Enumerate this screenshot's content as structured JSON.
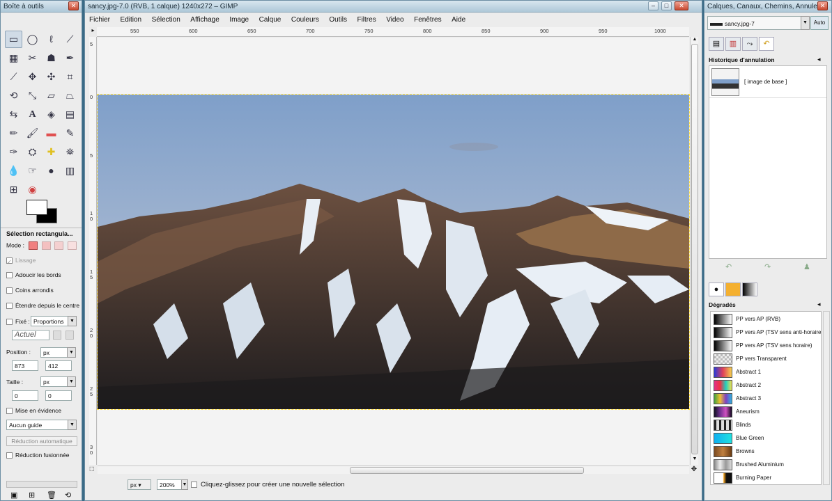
{
  "toolbox": {
    "title": "Boîte à outils",
    "options_title": "Sélection rectangula...",
    "mode_label": "Mode :",
    "antialias_label": "Lissage",
    "feather_label": "Adoucir les bords",
    "rounded_label": "Coins arrondis",
    "expand_label": "Étendre depuis le centre",
    "fixed_label": "Fixé :",
    "fixed_value": "Proportions",
    "current_label": "Actuel",
    "position_label": "Position :",
    "position_unit": "px",
    "position_x": "873",
    "position_y": "412",
    "size_label": "Taille :",
    "size_unit": "px",
    "size_w": "0",
    "size_h": "0",
    "highlight_label": "Mise en évidence",
    "guide_value": "Aucun guide",
    "auto_shrink_label": "Réduction automatique",
    "shrink_merged_label": "Réduction fusionnée"
  },
  "image_window": {
    "title": "sancy.jpg-7.0 (RVB, 1 calque) 1240x272 – GIMP",
    "menus": [
      "Fichier",
      "Edition",
      "Sélection",
      "Affichage",
      "Image",
      "Calque",
      "Couleurs",
      "Outils",
      "Filtres",
      "Video",
      "Fenêtres",
      "Aide"
    ],
    "ruler_marks": [
      "550",
      "600",
      "650",
      "700",
      "750",
      "800",
      "850",
      "900",
      "950",
      "1000"
    ],
    "vruler_marks": [
      "5",
      "0",
      "5",
      "1 0",
      "1 5",
      "2 0",
      "2 5",
      "3 0"
    ],
    "unit": "px",
    "zoom": "200%",
    "status": "Cliquez-glissez pour créer une nouvelle sélection"
  },
  "dock": {
    "title": "Calques, Canaux, Chemins, Annule...",
    "image_select": "sancy.jpg-7",
    "auto_label": "Auto",
    "history_title": "Historique d'annulation",
    "history_item": "[ image de base ]",
    "gradients_title": "Dégradés",
    "gradients": [
      {
        "name": "PP vers AP (RVB)",
        "css": "linear-gradient(90deg,#000,#fff)"
      },
      {
        "name": "PP vers AP (TSV sens anti-horaire)",
        "css": "linear-gradient(90deg,#000,#fff)"
      },
      {
        "name": "PP vers AP (TSV sens horaire)",
        "css": "linear-gradient(90deg,#000,#fff)"
      },
      {
        "name": "PP vers Transparent",
        "css": "repeating-conic-gradient(#bbb 0 25%,#eee 0 50%) 0 0/6px 6px"
      },
      {
        "name": "Abstract 1",
        "css": "linear-gradient(90deg,#2a3bd8,#e0405a,#f5d050)"
      },
      {
        "name": "Abstract 2",
        "css": "linear-gradient(90deg,#e0308a,#f03040,#20d0c0,#f0e050)"
      },
      {
        "name": "Abstract 3",
        "css": "linear-gradient(90deg,#40a040,#f0c030,#8040c0,#30b0e0)"
      },
      {
        "name": "Aneurism",
        "css": "linear-gradient(90deg,#101020,#703090,#d050c0,#100820)"
      },
      {
        "name": "Blinds",
        "css": "repeating-linear-gradient(90deg,#222 0 3px,#ddd 3px 7px)"
      },
      {
        "name": "Blue Green",
        "css": "linear-gradient(90deg,#10b0f0,#20e0e0)"
      },
      {
        "name": "Browns",
        "css": "linear-gradient(90deg,#7a4a20,#c08040,#6a3a10)"
      },
      {
        "name": "Brushed Aluminium",
        "css": "linear-gradient(90deg,#888,#eee,#999,#ddd)"
      },
      {
        "name": "Burning Paper",
        "css": "linear-gradient(90deg,#fff 50%,#f0a020 55%,#101010 70%)"
      }
    ]
  }
}
